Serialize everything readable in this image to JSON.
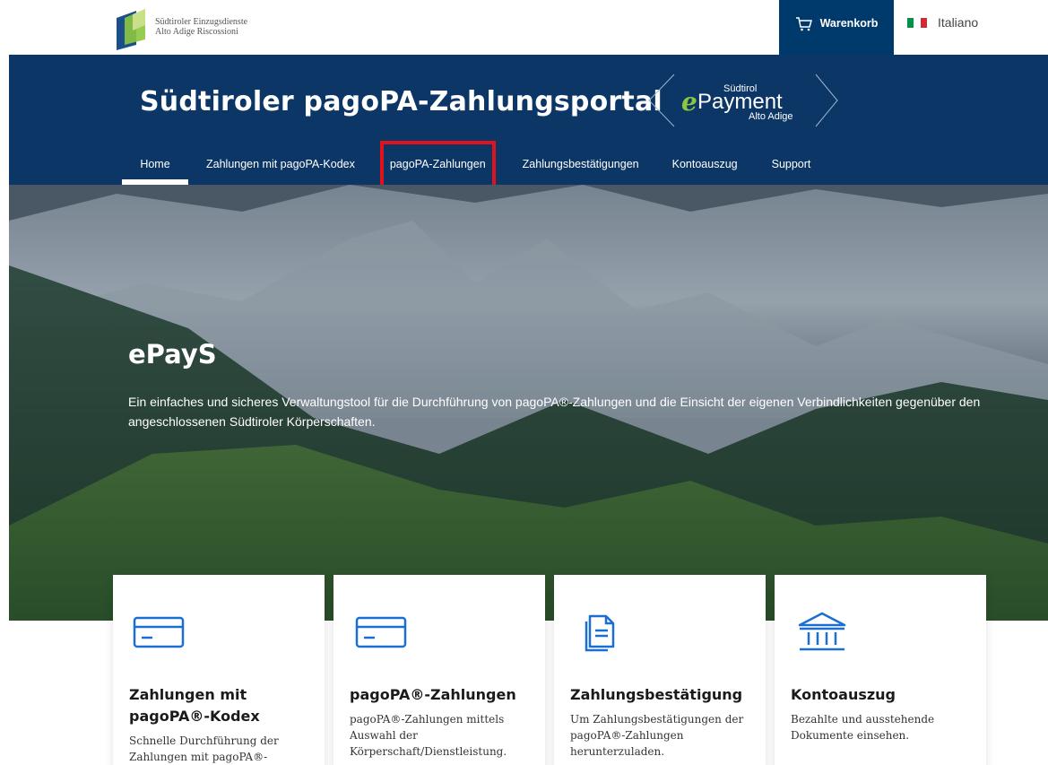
{
  "topbar": {
    "org_line1": "Südtiroler Einzugsdienste",
    "org_line2": "Alto Adige Riscossioni",
    "cart_label": "Warenkorb",
    "language_label": "Italiano"
  },
  "header": {
    "title": "Südtiroler pagoPA-Zahlungsportal",
    "brand_e": "e",
    "brand_top": "Südtirol",
    "brand_main": "Payment",
    "brand_bottom": "Alto Adige"
  },
  "nav": {
    "items": [
      {
        "label": "Home",
        "active": true
      },
      {
        "label": "Zahlungen mit pagoPA-Kodex",
        "active": false
      },
      {
        "label": "pagoPA-Zahlungen",
        "active": false,
        "highlighted": true
      },
      {
        "label": "Zahlungsbestätigungen",
        "active": false
      },
      {
        "label": "Kontoauszug",
        "active": false
      },
      {
        "label": "Support",
        "active": false
      }
    ]
  },
  "hero": {
    "title": "ePayS",
    "description": "Ein einfaches und sicheres Verwaltungstool für die Durchführung von pagoPA®-Zahlungen und die Einsicht der eigenen Verbindlichkeiten gegenüber den angeschlossenen Südtiroler Körperschaften."
  },
  "cards": [
    {
      "icon": "credit-card-icon",
      "title": "Zahlungen mit pagoPA®-Kodex",
      "description": "Schnelle Durchführung der Zahlungen mit pagoPA®-"
    },
    {
      "icon": "credit-card-icon",
      "title": "pagoPA®-Zahlungen",
      "description": "pagoPA®-Zahlungen mittels Auswahl der Körperschaft/Dienstleistung."
    },
    {
      "icon": "document-icon",
      "title": "Zahlungsbestätigung",
      "description": "Um Zahlungsbestätigungen der pagoPA®-Zahlungen herunterzuladen."
    },
    {
      "icon": "bank-icon",
      "title": "Kontoauszug",
      "description": "Bezahlte und ausstehende Dokumente einsehen."
    }
  ],
  "colors": {
    "brand_blue": "#0c3666",
    "cart_blue": "#003a6c",
    "icon_blue": "#1a6fd1",
    "highlight_red": "#e0121b"
  }
}
